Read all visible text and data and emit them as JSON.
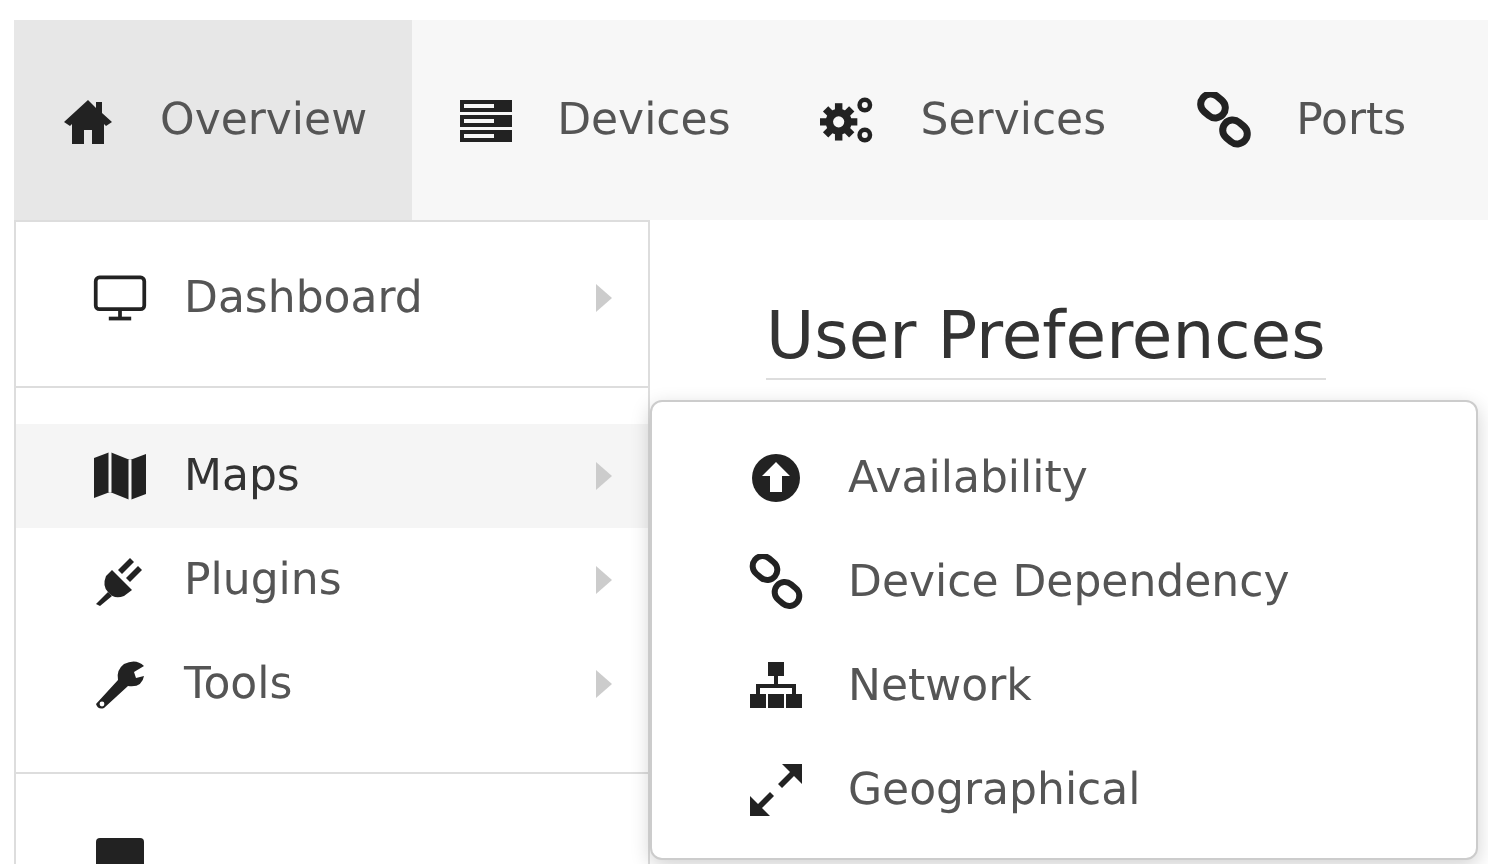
{
  "navbar": {
    "tabs": [
      {
        "label": "Overview",
        "selected": true
      },
      {
        "label": "Devices",
        "selected": false
      },
      {
        "label": "Services",
        "selected": false
      },
      {
        "label": "Ports",
        "selected": false
      }
    ]
  },
  "dropdown": {
    "items": [
      {
        "kind": "item",
        "label": "Dashboard",
        "has_submenu": true,
        "selected": false
      },
      {
        "kind": "separator"
      },
      {
        "kind": "item",
        "label": "Maps",
        "has_submenu": true,
        "selected": true
      },
      {
        "kind": "item",
        "label": "Plugins",
        "has_submenu": true,
        "selected": false
      },
      {
        "kind": "item",
        "label": "Tools",
        "has_submenu": true,
        "selected": false
      },
      {
        "kind": "separator"
      },
      {
        "kind": "item"
      }
    ]
  },
  "submenu": {
    "items": [
      {
        "label": "Availability"
      },
      {
        "label": "Device Dependency"
      },
      {
        "label": "Network"
      },
      {
        "label": "Geographical"
      }
    ]
  },
  "page": {
    "heading": "User Preferences"
  }
}
